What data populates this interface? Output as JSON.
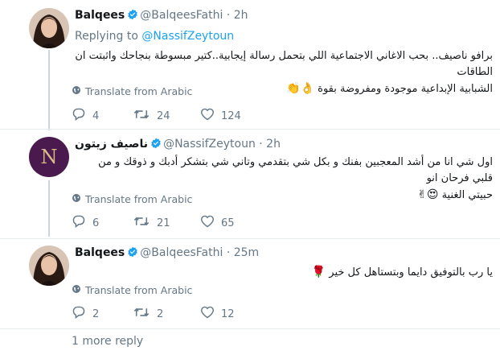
{
  "tweets": [
    {
      "name": "Balqees",
      "handle": "@BalqeesFathi",
      "dot": "·",
      "time": "2h",
      "replying_prefix": "Replying to",
      "replying_to": "@NassifZeytoun",
      "text_line1": "برافو ناصيف.. بحب الاغاني الاجتماعية اللي بتحمل رسالة إيجابية..كتير مبسوطة بنجاحك واثبتت ان الطاقات",
      "text_line2": "الشبابية الإبداعية موجودة ومفروضة بقوة",
      "emojis": "👌👏",
      "translate": "Translate from Arabic",
      "replies": "4",
      "retweets": "24",
      "likes": "124"
    },
    {
      "name": "ناصيف زيتون",
      "handle": "@NassifZeytoun",
      "dot": "·",
      "time": "2h",
      "avatar_letter": "N",
      "text_line1": "اول شي انا من أشد المعجبين بفنك و بكل شي بتقدمي وتاني شي بتشكر أدبك و ذوقك و من قلبي فرحان انو",
      "text_line2": "حبيتي الغنية",
      "emojis": "😍✌",
      "translate": "Translate from Arabic",
      "replies": "6",
      "retweets": "21",
      "likes": "65"
    },
    {
      "name": "Balqees",
      "handle": "@BalqeesFathi",
      "dot": "·",
      "time": "25m",
      "text_line1": "يا رب بالتوفيق دايما وبتستاهل كل خير",
      "emojis": "🌹",
      "translate": "Translate from Arabic",
      "replies": "2",
      "retweets": "2",
      "likes": "12"
    }
  ],
  "more_replies": "1 more reply",
  "colors": {
    "link": "#1da1f2",
    "muted": "#657786",
    "verified": "#1da1f2",
    "nassif_avatar_bg": "#4a1a4e"
  },
  "icons": [
    "verified-badge-icon",
    "globe-icon",
    "reply-icon",
    "retweet-icon",
    "like-icon"
  ]
}
